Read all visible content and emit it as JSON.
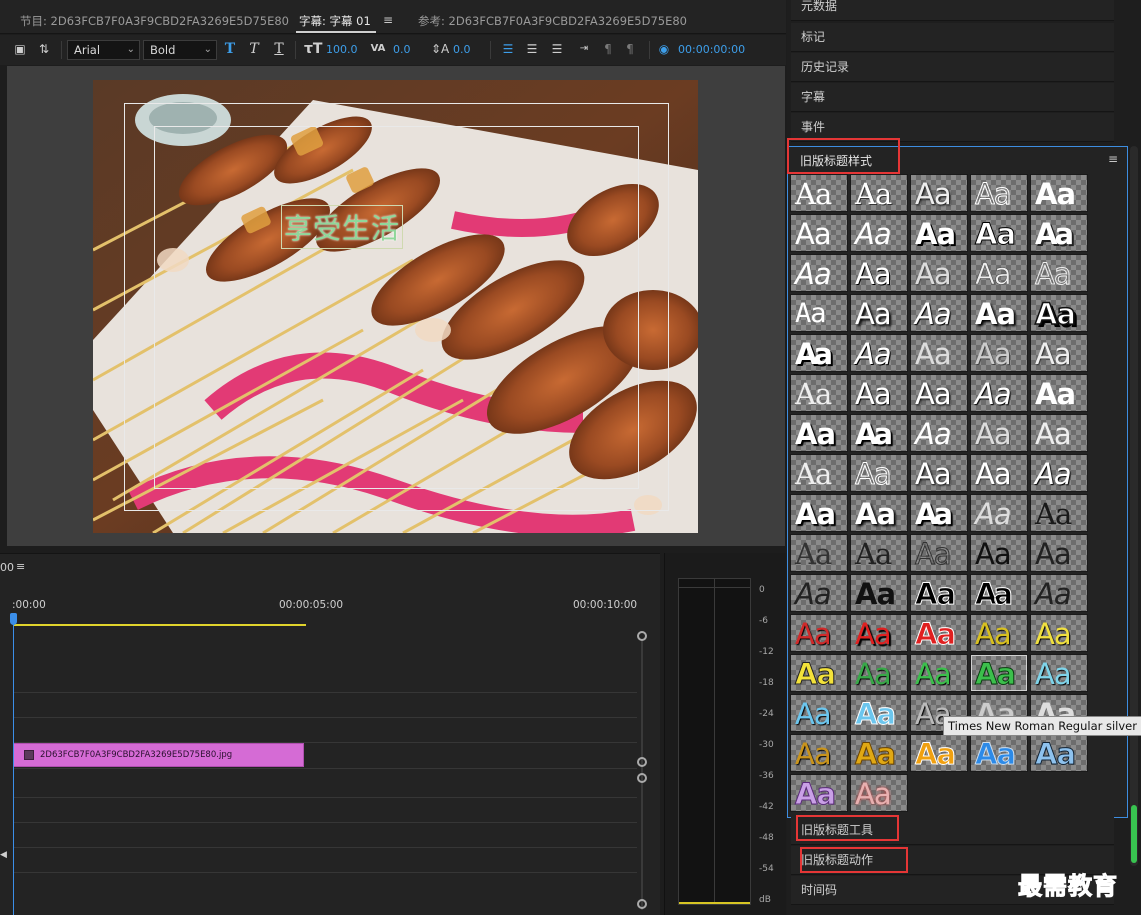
{
  "tabs": {
    "program": "节目: 2D63FCB7F0A3F9CBD2FA3269E5D75E80",
    "caption": "字幕: 字幕 01",
    "reference": "参考: 2D63FCB7F0A3F9CBD2FA3269E5D75E80"
  },
  "toolbar": {
    "font_family": "Arial",
    "font_style": "Bold",
    "font_size": "100.0",
    "kerning": "0.0",
    "leading": "0.0",
    "timecode": "00:00:00:00"
  },
  "preview": {
    "caption_text": "享受生活"
  },
  "timeline": {
    "timecode": "00",
    "ruler": [
      ":00:00",
      "00:00:05:00",
      "00:00:10:00"
    ],
    "clip_name": "2D63FCB7F0A3F9CBD2FA3269E5D75E80.jpg"
  },
  "meter": {
    "db_labels": [
      "0",
      "-6",
      "-12",
      "-18",
      "-24",
      "-30",
      "-36",
      "-42",
      "-48",
      "-54",
      "dB"
    ]
  },
  "right_panel": {
    "rows_top": [
      "元数据",
      "标记",
      "历史记录",
      "字幕",
      "事件"
    ],
    "styles_title": "旧版标题样式",
    "rows_bottom": [
      "旧版标题工具",
      "旧版标题动作",
      "时间码"
    ],
    "tooltip": "Times New Roman Regular silver",
    "swatch_text": "Aa"
  },
  "watermark": "最需教育"
}
